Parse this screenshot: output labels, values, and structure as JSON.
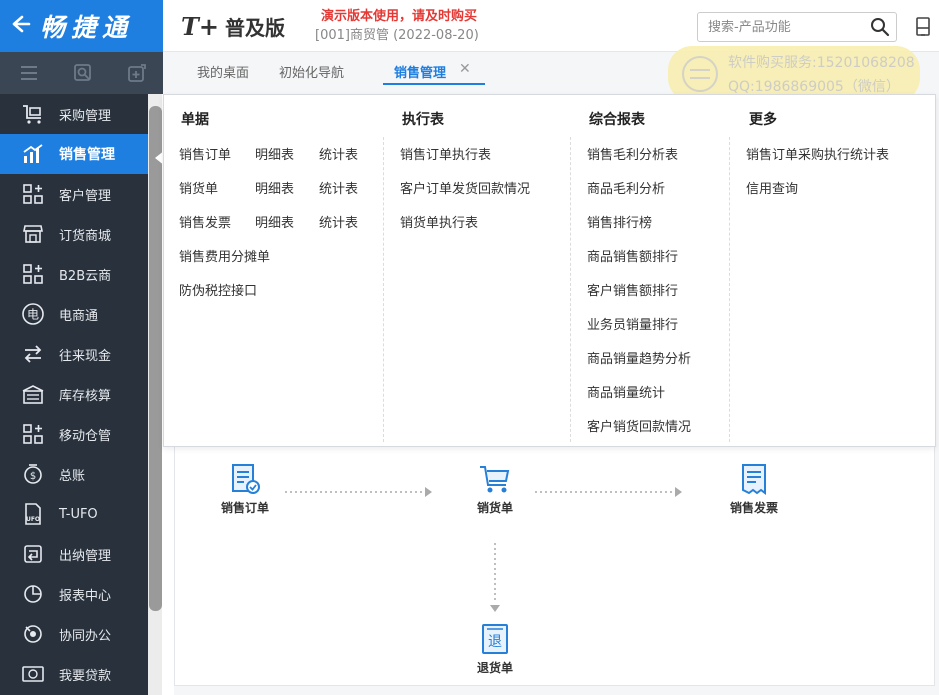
{
  "brand": {
    "name": "畅捷通"
  },
  "header": {
    "logo_mark": "T+",
    "edition": "普及版",
    "demo_notice": "演示版本使用，请及时购买",
    "company": "[001]商贸管  (2022-08-20)"
  },
  "search": {
    "placeholder": "搜索-产品功能"
  },
  "tabs": [
    {
      "label": "我的桌面"
    },
    {
      "label": "初始化导航"
    },
    {
      "label": "销售管理",
      "active": true
    }
  ],
  "watermark": {
    "line1": "软件购买服务:15201068208",
    "line2": "QQ:1986869005（微信）"
  },
  "sidebar": {
    "items": [
      {
        "label": "采购管理",
        "icon": "cart-icon"
      },
      {
        "label": "销售管理",
        "icon": "bar-chart-icon",
        "active": true
      },
      {
        "label": "客户管理",
        "icon": "grid-plus-icon"
      },
      {
        "label": "订货商城",
        "icon": "store-icon"
      },
      {
        "label": "B2B云商",
        "icon": "grid-plus-icon"
      },
      {
        "label": "电商通",
        "icon": "ecommerce-icon"
      },
      {
        "label": "往来现金",
        "icon": "exchange-icon"
      },
      {
        "label": "库存核算",
        "icon": "warehouse-icon"
      },
      {
        "label": "移动仓管",
        "icon": "grid-plus-icon"
      },
      {
        "label": "总账",
        "icon": "ledger-icon"
      },
      {
        "label": "T-UFO",
        "icon": "ufo-icon"
      },
      {
        "label": "出纳管理",
        "icon": "cashier-icon"
      },
      {
        "label": "报表中心",
        "icon": "pie-chart-icon"
      },
      {
        "label": "协同办公",
        "icon": "collab-icon"
      },
      {
        "label": "我要贷款",
        "icon": "loan-icon"
      }
    ]
  },
  "menu": {
    "documents": {
      "title": "单据",
      "rows": [
        [
          "销售订单",
          "明细表",
          "统计表"
        ],
        [
          "销货单",
          "明细表",
          "统计表"
        ],
        [
          "销售发票",
          "明细表",
          "统计表"
        ],
        [
          "销售费用分摊单"
        ],
        [
          "防伪税控接口"
        ]
      ]
    },
    "execution": {
      "title": "执行表",
      "items": [
        "销售订单执行表",
        "客户订单发货回款情况",
        "销货单执行表"
      ]
    },
    "reports": {
      "title": "综合报表",
      "items": [
        "销售毛利分析表",
        "商品毛利分析",
        "销售排行榜",
        "商品销售额排行",
        "客户销售额排行",
        "业务员销量排行",
        "商品销量趋势分析",
        "商品销量统计",
        "客户销货回款情况"
      ]
    },
    "more": {
      "title": "更多",
      "items": [
        "销售订单采购执行统计表",
        "信用查询"
      ]
    }
  },
  "flow": {
    "nodes": [
      {
        "label": "销售订单",
        "icon": "sales-order-icon"
      },
      {
        "label": "销货单",
        "icon": "delivery-cart-icon"
      },
      {
        "label": "销售发票",
        "icon": "invoice-icon"
      },
      {
        "label": "退货单",
        "icon": "return-icon",
        "glyph": "退"
      }
    ]
  },
  "colors": {
    "accent": "#1f7fe0",
    "sidebar": "#28313c",
    "toolbar": "#3a4654",
    "demo": "#e53935"
  }
}
